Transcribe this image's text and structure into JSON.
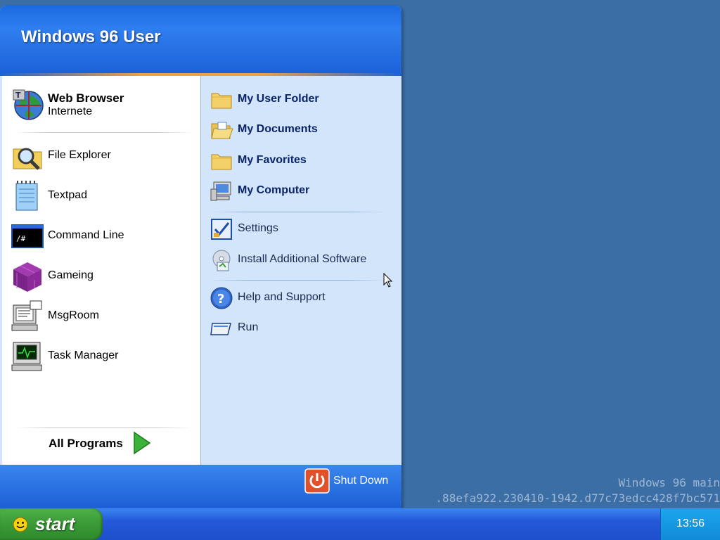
{
  "desktop": {
    "watermark_line1": "Windows 96 main",
    "watermark_line2": ".88efa922.230410-1942.d77c73edcc428f7bc571"
  },
  "start_menu": {
    "user_name": "Windows 96 User",
    "pinned": {
      "title": "Web Browser",
      "subtitle": "Internete",
      "icon": "globe-icon"
    },
    "programs": [
      {
        "label": "File Explorer",
        "icon": "folder-search-icon"
      },
      {
        "label": "Textpad",
        "icon": "notepad-icon"
      },
      {
        "label": "Command Line",
        "icon": "terminal-icon"
      },
      {
        "label": "Gameing",
        "icon": "cube-icon"
      },
      {
        "label": "MsgRoom",
        "icon": "chat-computer-icon"
      },
      {
        "label": "Task Manager",
        "icon": "monitor-pulse-icon"
      }
    ],
    "all_programs_label": "All Programs",
    "places": [
      {
        "label": "My User Folder",
        "icon": "folder-icon"
      },
      {
        "label": "My Documents",
        "icon": "open-folder-icon"
      },
      {
        "label": "My Favorites",
        "icon": "folder-icon"
      },
      {
        "label": "My Computer",
        "icon": "computer-icon"
      }
    ],
    "system": [
      {
        "label": "Settings",
        "icon": "settings-check-icon"
      },
      {
        "label": "Install Additional Software",
        "icon": "install-disc-icon"
      }
    ],
    "help": [
      {
        "label": "Help and Support",
        "icon": "help-icon"
      },
      {
        "label": "Run",
        "icon": "run-icon"
      }
    ],
    "shutdown_label": "Shut Down"
  },
  "taskbar": {
    "start_label": "start",
    "clock": "13:56"
  },
  "colors": {
    "desktop": "#3a6ea5",
    "header_blue": "#1d62d8",
    "right_pane": "#d3e5fa",
    "start_green": "#3a9a36",
    "shutdown_red": "#e0502a"
  }
}
